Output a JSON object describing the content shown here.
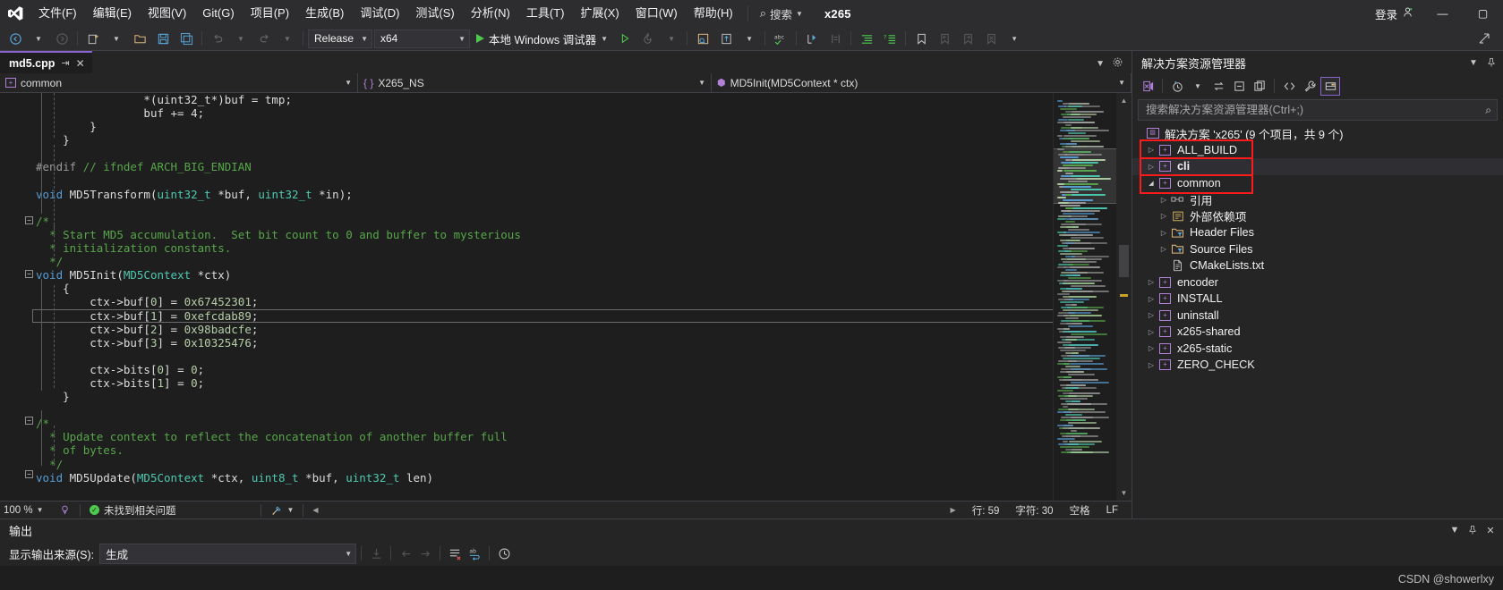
{
  "titlebar": {
    "logo": "visual-studio-logo",
    "menus": [
      {
        "label": "文件(F)"
      },
      {
        "label": "编辑(E)"
      },
      {
        "label": "视图(V)"
      },
      {
        "label": "Git(G)"
      },
      {
        "label": "项目(P)"
      },
      {
        "label": "生成(B)"
      },
      {
        "label": "调试(D)"
      },
      {
        "label": "测试(S)"
      },
      {
        "label": "分析(N)"
      },
      {
        "label": "工具(T)"
      },
      {
        "label": "扩展(X)"
      },
      {
        "label": "窗口(W)"
      },
      {
        "label": "帮助(H)"
      }
    ],
    "search_label": "搜索",
    "solution_name": "x265",
    "signin_label": "登录",
    "minimize": "—",
    "maximize": "▢"
  },
  "toolbar": {
    "config": "Release",
    "platform": "x64",
    "run_label": "本地 Windows 调试器"
  },
  "editor": {
    "tab": {
      "name": "md5.cpp",
      "pin": "⌐",
      "close": "✕"
    },
    "nav": {
      "project": "common",
      "namespace": "X265_NS",
      "member": "MD5Init(MD5Context * ctx)"
    },
    "lines": [
      {
        "indent": 8,
        "segs": [
          {
            "t": "*(uint32_t*)buf = tmp;",
            "c": "op"
          }
        ]
      },
      {
        "indent": 8,
        "segs": [
          {
            "t": "buf += 4;",
            "c": "op"
          }
        ]
      },
      {
        "indent": 4,
        "segs": [
          {
            "t": "}",
            "c": "op"
          }
        ]
      },
      {
        "indent": 2,
        "segs": [
          {
            "t": "}",
            "c": "op"
          }
        ]
      },
      {
        "indent": 0,
        "segs": []
      },
      {
        "indent": 0,
        "segs": [
          {
            "t": "#endif ",
            "c": "pp"
          },
          {
            "t": "// ifndef ARCH_BIG_ENDIAN",
            "c": "cm"
          }
        ]
      },
      {
        "indent": 0,
        "segs": []
      },
      {
        "indent": 0,
        "segs": [
          {
            "t": "void ",
            "c": "kw"
          },
          {
            "t": "MD5Transform(",
            "c": "fn"
          },
          {
            "t": "uint32_t",
            "c": "ty"
          },
          {
            "t": " *buf, ",
            "c": "op"
          },
          {
            "t": "uint32_t",
            "c": "ty"
          },
          {
            "t": " *in);",
            "c": "op"
          }
        ]
      },
      {
        "indent": 0,
        "segs": []
      },
      {
        "indent": 0,
        "segs": [
          {
            "t": "/*",
            "c": "cm"
          }
        ]
      },
      {
        "indent": 1,
        "segs": [
          {
            "t": "* Start MD5 accumulation.  Set bit count to 0 and buffer to mysterious",
            "c": "cm"
          }
        ]
      },
      {
        "indent": 1,
        "segs": [
          {
            "t": "* initialization constants.",
            "c": "cm"
          }
        ]
      },
      {
        "indent": 1,
        "segs": [
          {
            "t": "*/",
            "c": "cm"
          }
        ]
      },
      {
        "indent": 0,
        "segs": [
          {
            "t": "void ",
            "c": "kw"
          },
          {
            "t": "MD5Init(",
            "c": "fn"
          },
          {
            "t": "MD5Context",
            "c": "ty"
          },
          {
            "t": " *ctx)",
            "c": "op"
          }
        ]
      },
      {
        "indent": 2,
        "segs": [
          {
            "t": "{",
            "c": "op"
          }
        ]
      },
      {
        "indent": 4,
        "segs": [
          {
            "t": "ctx->buf[",
            "c": "op"
          },
          {
            "t": "0",
            "c": "num"
          },
          {
            "t": "] = ",
            "c": "op"
          },
          {
            "t": "0x67452301",
            "c": "num"
          },
          {
            "t": ";",
            "c": "op"
          }
        ]
      },
      {
        "indent": 4,
        "current": true,
        "segs": [
          {
            "t": "ctx->buf[",
            "c": "op"
          },
          {
            "t": "1",
            "c": "num"
          },
          {
            "t": "] = ",
            "c": "op"
          },
          {
            "t": "0xefcdab89",
            "c": "num"
          },
          {
            "t": ";",
            "c": "op"
          }
        ]
      },
      {
        "indent": 4,
        "segs": [
          {
            "t": "ctx->buf[",
            "c": "op"
          },
          {
            "t": "2",
            "c": "num"
          },
          {
            "t": "] = ",
            "c": "op"
          },
          {
            "t": "0x98badcfe",
            "c": "num"
          },
          {
            "t": ";",
            "c": "op"
          }
        ]
      },
      {
        "indent": 4,
        "segs": [
          {
            "t": "ctx->buf[",
            "c": "op"
          },
          {
            "t": "3",
            "c": "num"
          },
          {
            "t": "] = ",
            "c": "op"
          },
          {
            "t": "0x10325476",
            "c": "num"
          },
          {
            "t": ";",
            "c": "op"
          }
        ]
      },
      {
        "indent": 0,
        "segs": []
      },
      {
        "indent": 4,
        "segs": [
          {
            "t": "ctx->bits[",
            "c": "op"
          },
          {
            "t": "0",
            "c": "num"
          },
          {
            "t": "] = ",
            "c": "op"
          },
          {
            "t": "0",
            "c": "num"
          },
          {
            "t": ";",
            "c": "op"
          }
        ]
      },
      {
        "indent": 4,
        "segs": [
          {
            "t": "ctx->bits[",
            "c": "op"
          },
          {
            "t": "1",
            "c": "num"
          },
          {
            "t": "] = ",
            "c": "op"
          },
          {
            "t": "0",
            "c": "num"
          },
          {
            "t": ";",
            "c": "op"
          }
        ]
      },
      {
        "indent": 2,
        "segs": [
          {
            "t": "}",
            "c": "op"
          }
        ]
      },
      {
        "indent": 0,
        "segs": []
      },
      {
        "indent": 0,
        "segs": [
          {
            "t": "/*",
            "c": "cm"
          }
        ]
      },
      {
        "indent": 1,
        "segs": [
          {
            "t": "* Update context to reflect the concatenation of another buffer full",
            "c": "cm"
          }
        ]
      },
      {
        "indent": 1,
        "segs": [
          {
            "t": "* of bytes.",
            "c": "cm"
          }
        ]
      },
      {
        "indent": 1,
        "segs": [
          {
            "t": "*/",
            "c": "cm"
          }
        ]
      },
      {
        "indent": 0,
        "segs": [
          {
            "t": "void ",
            "c": "kw"
          },
          {
            "t": "MD5Update(",
            "c": "fn"
          },
          {
            "t": "MD5Context",
            "c": "ty"
          },
          {
            "t": " *ctx, ",
            "c": "op"
          },
          {
            "t": "uint8_t",
            "c": "ty"
          },
          {
            "t": " *buf, ",
            "c": "op"
          },
          {
            "t": "uint32_t",
            "c": "ty"
          },
          {
            "t": " len)",
            "c": "op"
          }
        ]
      }
    ],
    "status": {
      "zoom": "100 %",
      "issues": "未找到相关问题",
      "line": "行: 59",
      "col": "字符: 30",
      "spaces": "空格",
      "eol": "LF"
    }
  },
  "solution_explorer": {
    "title": "解决方案资源管理器",
    "search_placeholder": "搜索解决方案资源管理器(Ctrl+;)",
    "root": "解决方案 'x265' (9 个项目，共 9 个)",
    "items": [
      {
        "label": "ALL_BUILD",
        "icon": "project-icon",
        "depth": 1,
        "arrow": "▷",
        "bold": false
      },
      {
        "label": "cli",
        "icon": "project-icon",
        "depth": 1,
        "arrow": "▷",
        "bold": true,
        "selected": true
      },
      {
        "label": "common",
        "icon": "project-icon",
        "depth": 1,
        "arrow": "◢",
        "bold": false
      },
      {
        "label": "引用",
        "icon": "references-icon",
        "depth": 2,
        "arrow": "▷",
        "bold": false
      },
      {
        "label": "外部依赖项",
        "icon": "dependencies-icon",
        "depth": 2,
        "arrow": "▷",
        "bold": false
      },
      {
        "label": "Header Files",
        "icon": "folder-filter-icon",
        "depth": 2,
        "arrow": "▷",
        "bold": false
      },
      {
        "label": "Source Files",
        "icon": "folder-filter-icon",
        "depth": 2,
        "arrow": "▷",
        "bold": false
      },
      {
        "label": "CMakeLists.txt",
        "icon": "file-icon",
        "depth": 2,
        "arrow": "",
        "bold": false
      },
      {
        "label": "encoder",
        "icon": "project-icon",
        "depth": 1,
        "arrow": "▷",
        "bold": false
      },
      {
        "label": "INSTALL",
        "icon": "project-icon",
        "depth": 1,
        "arrow": "▷",
        "bold": false
      },
      {
        "label": "uninstall",
        "icon": "project-icon",
        "depth": 1,
        "arrow": "▷",
        "bold": false
      },
      {
        "label": "x265-shared",
        "icon": "project-icon",
        "depth": 1,
        "arrow": "▷",
        "bold": false
      },
      {
        "label": "x265-static",
        "icon": "project-icon",
        "depth": 1,
        "arrow": "▷",
        "bold": false
      },
      {
        "label": "ZERO_CHECK",
        "icon": "project-icon",
        "depth": 1,
        "arrow": "▷",
        "bold": false
      }
    ],
    "annotation_color": "#fc1b1b"
  },
  "output": {
    "title": "输出",
    "source_label": "显示输出来源(S):",
    "source_value": "生成"
  },
  "watermark": "CSDN @showerlxy"
}
